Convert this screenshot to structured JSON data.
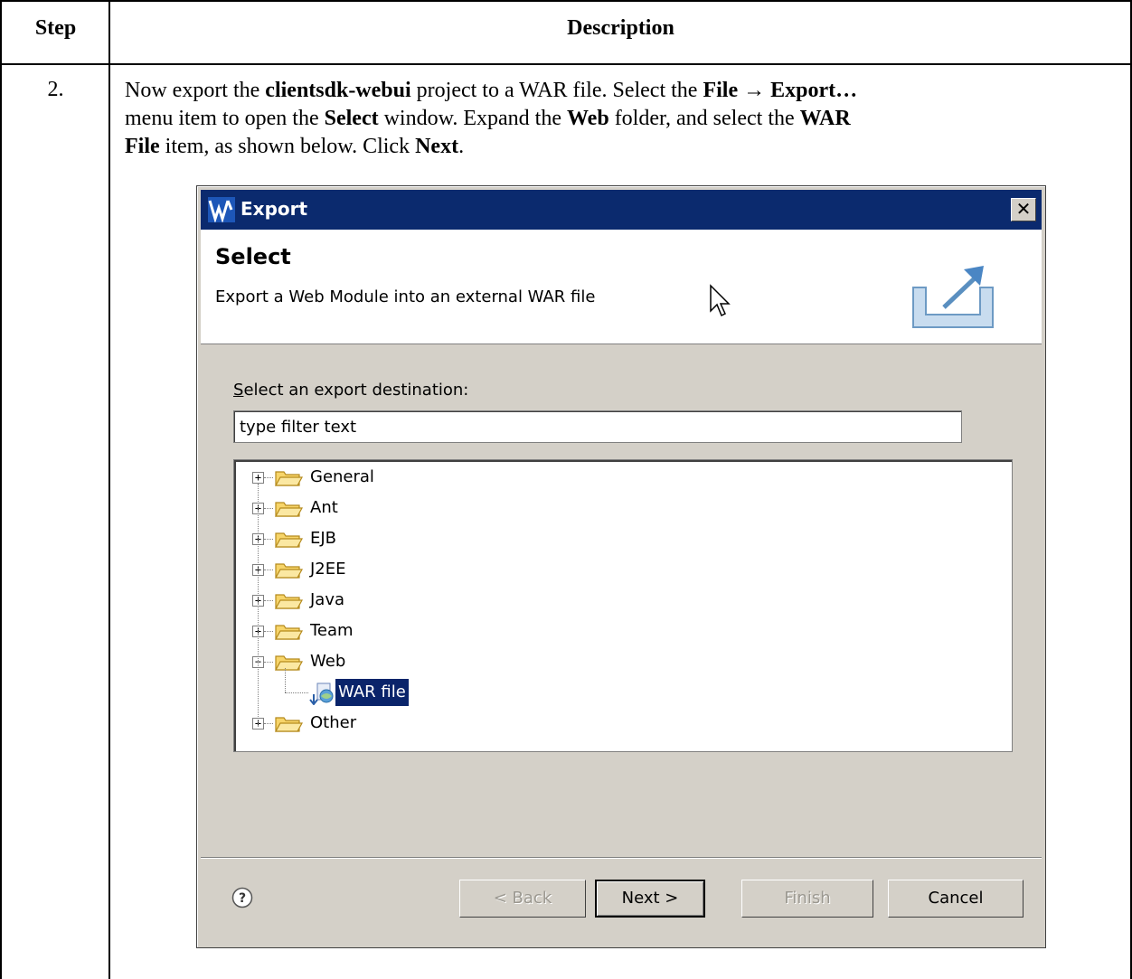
{
  "table": {
    "header_step": "Step",
    "header_description": "Description",
    "step_number": "2."
  },
  "instructions": {
    "line1": [
      {
        "t": "Now export the ",
        "b": false
      },
      {
        "t": "clientsdk-webui",
        "b": true
      },
      {
        "t": " project to a WAR file. Select the ",
        "b": false
      },
      {
        "t": "File → Export…",
        "b": true
      }
    ],
    "line2": [
      {
        "t": "menu item to open the ",
        "b": false
      },
      {
        "t": "Select",
        "b": true
      },
      {
        "t": " window. Expand the ",
        "b": false
      },
      {
        "t": "Web",
        "b": true
      },
      {
        "t": " folder, and select the ",
        "b": false
      },
      {
        "t": "WAR",
        "b": true
      }
    ],
    "line3": [
      {
        "t": "File",
        "b": true
      },
      {
        "t": " item, as shown below. Click ",
        "b": false
      },
      {
        "t": "Next",
        "b": true
      },
      {
        "t": ".",
        "b": false
      }
    ]
  },
  "dialog": {
    "title": "Export",
    "close_glyph": "✕",
    "banner_title": "Select",
    "banner_subtitle": "Export a Web Module into an external WAR file",
    "destination_label": "Select an export destination:",
    "destination_label_mnemonic": "S",
    "destination_label_rest": "elect an export destination:",
    "filter_value": "type filter text",
    "tree": [
      {
        "label": "General",
        "expanded": false
      },
      {
        "label": "Ant",
        "expanded": false
      },
      {
        "label": "EJB",
        "expanded": false
      },
      {
        "label": "J2EE",
        "expanded": false
      },
      {
        "label": "Java",
        "expanded": false
      },
      {
        "label": "Team",
        "expanded": false
      },
      {
        "label": "Web",
        "expanded": true
      },
      {
        "label": "WAR file",
        "child": true,
        "selected": true
      },
      {
        "label": "Other",
        "expanded": false
      }
    ],
    "buttons": {
      "back": "< Back",
      "next": "Next >",
      "finish": "Finish",
      "cancel": "Cancel"
    },
    "help_glyph": "?"
  },
  "colors": {
    "title_bar": "#0b2a6e",
    "selection": "#0a246a",
    "dialog_bg": "#d4d0c8"
  }
}
